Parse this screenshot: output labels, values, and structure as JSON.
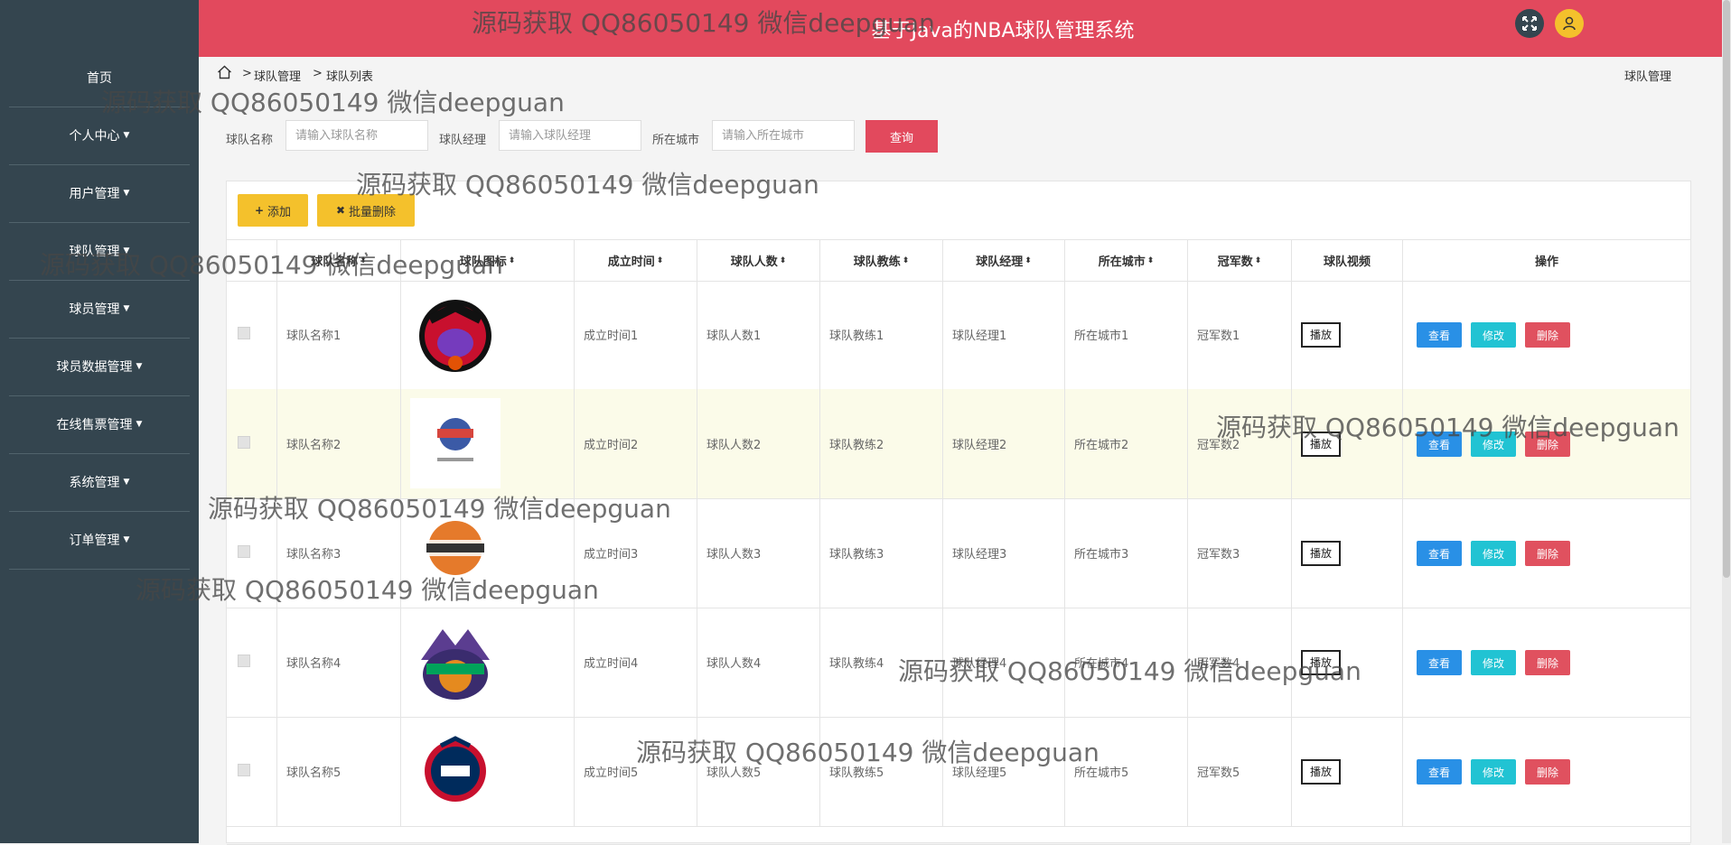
{
  "sidebar": {
    "items": [
      {
        "label": "首页",
        "dropdown": false
      },
      {
        "label": "个人中心",
        "dropdown": true
      },
      {
        "label": "用户管理",
        "dropdown": true
      },
      {
        "label": "球队管理",
        "dropdown": true
      },
      {
        "label": "球员管理",
        "dropdown": true
      },
      {
        "label": "球员数据管理",
        "dropdown": true
      },
      {
        "label": "在线售票管理",
        "dropdown": true
      },
      {
        "label": "系统管理",
        "dropdown": true
      },
      {
        "label": "订单管理",
        "dropdown": true
      }
    ]
  },
  "header": {
    "title": "基于Java的NBA球队管理系统",
    "icons": [
      "fullscreen-icon",
      "user-icon"
    ],
    "colors": {
      "header": "#e2495d",
      "sidebar": "#34454f"
    }
  },
  "breadcrumb": {
    "home_icon": "home-icon",
    "separator": ">",
    "items": [
      "球队管理",
      "球队列表"
    ],
    "right_label": "球队管理"
  },
  "search": {
    "fields": [
      {
        "label": "球队名称",
        "placeholder": "请输入球队名称"
      },
      {
        "label": "球队经理",
        "placeholder": "请输入球队经理"
      },
      {
        "label": "所在城市",
        "placeholder": "请输入所在城市"
      }
    ],
    "query_label": "查询"
  },
  "toolbar": {
    "add_icon": "plus-icon",
    "add_label": "添加",
    "batch_icon": "times-icon",
    "batch_delete_label": "批量删除"
  },
  "table": {
    "columns": [
      "球队名称",
      "球队图标",
      "成立时间",
      "球队人数",
      "球队教练",
      "球队经理",
      "所在城市",
      "冠军数",
      "球队视频",
      "操作"
    ],
    "sortable": [
      true,
      true,
      true,
      true,
      true,
      true,
      true,
      true,
      false,
      false
    ],
    "play_label": "播放",
    "action_labels": {
      "view": "查看",
      "edit": "修改",
      "delete": "删除"
    },
    "rows": [
      {
        "name": "球队名称1",
        "logo": "raptors-logo",
        "founded": "成立时间1",
        "players": "球队人数1",
        "coach": "球队教练1",
        "manager": "球队经理1",
        "city": "所在城市1",
        "titles": "冠军数1"
      },
      {
        "name": "球队名称2",
        "logo": "league-logo",
        "founded": "成立时间2",
        "players": "球队人数2",
        "coach": "球队教练2",
        "manager": "球队经理2",
        "city": "所在城市2",
        "titles": "冠军数2"
      },
      {
        "name": "球队名称3",
        "logo": "cuba-logo",
        "founded": "成立时间3",
        "players": "球队人数3",
        "coach": "球队教练3",
        "manager": "球队经理3",
        "city": "所在城市3",
        "titles": "冠军数3"
      },
      {
        "name": "球队名称4",
        "logo": "jazz-logo",
        "founded": "成立时间4",
        "players": "球队人数4",
        "coach": "球队教练4",
        "manager": "球队经理4",
        "city": "所在城市4",
        "titles": "冠军数4"
      },
      {
        "name": "球队名称5",
        "logo": "wizards-logo",
        "founded": "成立时间5",
        "players": "球队人数5",
        "coach": "球队教练5",
        "manager": "球队经理5",
        "city": "所在城市5",
        "titles": "冠军数5"
      }
    ]
  },
  "watermark": {
    "text": "源码获取 QQ86050149 微信deepguan"
  }
}
